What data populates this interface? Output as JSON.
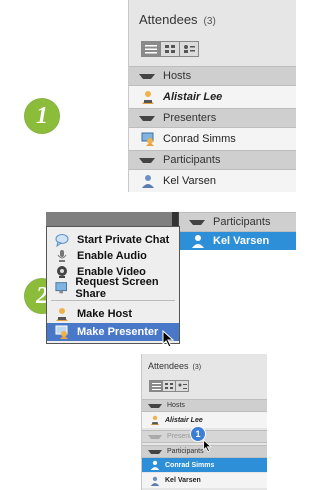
{
  "steps": [
    "1",
    "2",
    "1"
  ],
  "panel1": {
    "title": "Attendees",
    "count": "(3)",
    "sections": {
      "hosts": "Hosts",
      "presenters": "Presenters",
      "participants": "Participants"
    },
    "hosts": [
      "Alistair Lee"
    ],
    "presenters": [
      "Conrad Simms"
    ],
    "participants": [
      "Kel Varsen"
    ]
  },
  "panel2": {
    "section": "Participants",
    "selected_attendee": "Kel Varsen",
    "menu": [
      {
        "label": "Start Private Chat",
        "icon": "chat-bubble-icon"
      },
      {
        "label": "Enable Audio",
        "icon": "microphone-icon"
      },
      {
        "label": "Enable Video",
        "icon": "webcam-icon"
      },
      {
        "label": "Request Screen Share",
        "icon": "screen-share-icon"
      },
      {
        "label": "Make Host",
        "icon": "host-icon"
      },
      {
        "label": "Make Presenter",
        "icon": "presenter-icon"
      }
    ]
  },
  "panel3": {
    "title": "Attendees",
    "count": "(3)",
    "sections": {
      "hosts": "Hosts",
      "presenters": "Presenters",
      "participants": "Participants"
    },
    "hosts": [
      "Alistair Lee"
    ],
    "participants": [
      "Conrad Simms",
      "Kel Varsen"
    ]
  },
  "colors": {
    "accent_blue": "#2d8fd8",
    "menu_highlight": "#4a78c9",
    "badge_green": "#8cbd3a",
    "badge_blue": "#3b7ed6"
  }
}
